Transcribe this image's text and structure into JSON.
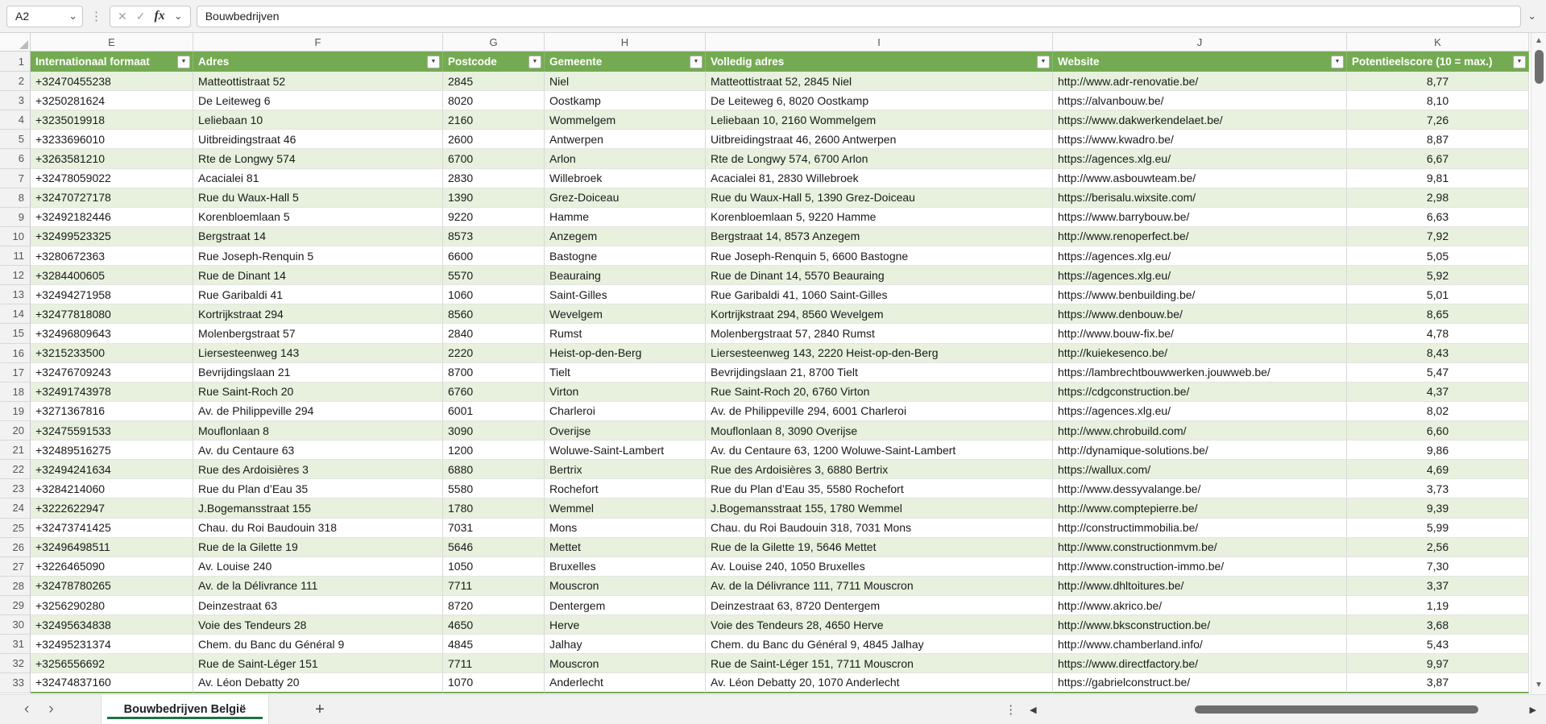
{
  "toolbar": {
    "name_box": "A2",
    "fx_label": "fx",
    "formula_value": "Bouwbedrijven"
  },
  "icons": {
    "chevron_down": "⌄",
    "cancel": "✕",
    "confirm": "✓",
    "kebab": "⋮",
    "prev": "‹",
    "next": "›",
    "plus": "+",
    "up": "▲",
    "down": "▼",
    "left": "◀",
    "right": "▶",
    "filter_arrow": "▼",
    "select_all_corner": "corner-triangle"
  },
  "colors": {
    "header_green": "#74AB52",
    "band_green": "#E7F1DE",
    "tab_underline_green": "#1E7145"
  },
  "columns": {
    "letters": [
      "E",
      "F",
      "G",
      "H",
      "I",
      "J",
      "K"
    ]
  },
  "table": {
    "headers": [
      "Internationaal formaat",
      "Adres",
      "Postcode",
      "Gemeente",
      "Volledig adres",
      "Website",
      "Potentieelscore (10 = max.)"
    ],
    "header_row_number": "1",
    "row_numbers": [
      "2",
      "3",
      "4",
      "5",
      "6",
      "7",
      "8",
      "9",
      "10",
      "11",
      "12",
      "13",
      "14",
      "15",
      "16",
      "17",
      "18",
      "19",
      "20",
      "21",
      "22",
      "23",
      "24",
      "25",
      "26",
      "27",
      "28",
      "29",
      "30",
      "31",
      "32",
      "33"
    ],
    "rows": [
      [
        "+32470455238",
        "Matteottistraat 52",
        "2845",
        "Niel",
        "Matteottistraat 52, 2845 Niel",
        "http://www.adr-renovatie.be/",
        "8,77"
      ],
      [
        "+3250281624",
        "De Leiteweg 6",
        "8020",
        "Oostkamp",
        "De Leiteweg 6, 8020 Oostkamp",
        "https://alvanbouw.be/",
        "8,10"
      ],
      [
        "+3235019918",
        "Leliebaan 10",
        "2160",
        "Wommelgem",
        "Leliebaan 10, 2160 Wommelgem",
        "https://www.dakwerkendelaet.be/",
        "7,26"
      ],
      [
        "+3233696010",
        "Uitbreidingstraat 46",
        "2600",
        "Antwerpen",
        "Uitbreidingstraat 46, 2600 Antwerpen",
        "https://www.kwadro.be/",
        "8,87"
      ],
      [
        "+3263581210",
        "Rte de Longwy 574",
        "6700",
        "Arlon",
        "Rte de Longwy 574, 6700 Arlon",
        "https://agences.xlg.eu/",
        "6,67"
      ],
      [
        "+32478059022",
        "Acacialei 81",
        "2830",
        "Willebroek",
        "Acacialei 81, 2830 Willebroek",
        "http://www.asbouwteam.be/",
        "9,81"
      ],
      [
        "+32470727178",
        "Rue du Waux-Hall 5",
        "1390",
        "Grez-Doiceau",
        "Rue du Waux-Hall 5, 1390 Grez-Doiceau",
        "https://berisalu.wixsite.com/",
        "2,98"
      ],
      [
        "+32492182446",
        "Korenbloemlaan 5",
        "9220",
        "Hamme",
        "Korenbloemlaan 5, 9220 Hamme",
        "https://www.barrybouw.be/",
        "6,63"
      ],
      [
        "+32499523325",
        "Bergstraat 14",
        "8573",
        "Anzegem",
        "Bergstraat 14, 8573 Anzegem",
        "http://www.renoperfect.be/",
        "7,92"
      ],
      [
        "+3280672363",
        "Rue Joseph-Renquin 5",
        "6600",
        "Bastogne",
        "Rue Joseph-Renquin 5, 6600 Bastogne",
        "https://agences.xlg.eu/",
        "5,05"
      ],
      [
        "+3284400605",
        "Rue de Dinant 14",
        "5570",
        "Beauraing",
        "Rue de Dinant 14, 5570 Beauraing",
        "https://agences.xlg.eu/",
        "5,92"
      ],
      [
        "+32494271958",
        "Rue Garibaldi 41",
        "1060",
        "Saint-Gilles",
        "Rue Garibaldi 41, 1060 Saint-Gilles",
        "https://www.benbuilding.be/",
        "5,01"
      ],
      [
        "+32477818080",
        "Kortrijkstraat 294",
        "8560",
        "Wevelgem",
        "Kortrijkstraat 294, 8560 Wevelgem",
        "https://www.denbouw.be/",
        "8,65"
      ],
      [
        "+32496809643",
        "Molenbergstraat 57",
        "2840",
        "Rumst",
        "Molenbergstraat 57, 2840 Rumst",
        "http://www.bouw-fix.be/",
        "4,78"
      ],
      [
        "+3215233500",
        "Liersesteenweg 143",
        "2220",
        "Heist-op-den-Berg",
        "Liersesteenweg 143, 2220 Heist-op-den-Berg",
        "http://kuiekesenco.be/",
        "8,43"
      ],
      [
        "+32476709243",
        "Bevrijdingslaan 21",
        "8700",
        "Tielt",
        "Bevrijdingslaan 21, 8700 Tielt",
        "https://lambrechtbouwwerken.jouwweb.be/",
        "5,47"
      ],
      [
        "+32491743978",
        "Rue Saint-Roch 20",
        "6760",
        "Virton",
        "Rue Saint-Roch 20, 6760 Virton",
        "https://cdgconstruction.be/",
        "4,37"
      ],
      [
        "+3271367816",
        "Av. de Philippeville 294",
        "6001",
        "Charleroi",
        "Av. de Philippeville 294, 6001 Charleroi",
        "https://agences.xlg.eu/",
        "8,02"
      ],
      [
        "+32475591533",
        "Mouflonlaan 8",
        "3090",
        "Overijse",
        "Mouflonlaan 8, 3090 Overijse",
        "http://www.chrobuild.com/",
        "6,60"
      ],
      [
        "+32489516275",
        "Av. du Centaure 63",
        "1200",
        "Woluwe-Saint-Lambert",
        "Av. du Centaure 63, 1200 Woluwe-Saint-Lambert",
        "http://dynamique-solutions.be/",
        "9,86"
      ],
      [
        "+32494241634",
        "Rue des Ardoisières 3",
        "6880",
        "Bertrix",
        "Rue des Ardoisières 3, 6880 Bertrix",
        "https://wallux.com/",
        "4,69"
      ],
      [
        "+3284214060",
        "Rue du Plan d’Eau 35",
        "5580",
        "Rochefort",
        "Rue du Plan d’Eau 35, 5580 Rochefort",
        "http://www.dessyvalange.be/",
        "3,73"
      ],
      [
        "+3222622947",
        "J.Bogemansstraat 155",
        "1780",
        "Wemmel",
        "J.Bogemansstraat 155, 1780 Wemmel",
        "http://www.comptepierre.be/",
        "9,39"
      ],
      [
        "+32473741425",
        "Chau. du Roi Baudouin 318",
        "7031",
        "Mons",
        "Chau. du Roi Baudouin 318, 7031 Mons",
        "http://constructimmobilia.be/",
        "5,99"
      ],
      [
        "+32496498511",
        "Rue de la Gilette 19",
        "5646",
        "Mettet",
        "Rue de la Gilette 19, 5646 Mettet",
        "http://www.constructionmvm.be/",
        "2,56"
      ],
      [
        "+3226465090",
        "Av. Louise 240",
        "1050",
        "Bruxelles",
        "Av. Louise 240, 1050 Bruxelles",
        "http://www.construction-immo.be/",
        "7,30"
      ],
      [
        "+32478780265",
        "Av. de la Délivrance 111",
        "7711",
        "Mouscron",
        "Av. de la Délivrance 111, 7711 Mouscron",
        "http://www.dhltoitures.be/",
        "3,37"
      ],
      [
        "+3256290280",
        "Deinzestraat 63",
        "8720",
        "Dentergem",
        "Deinzestraat 63, 8720 Dentergem",
        "http://www.akrico.be/",
        "1,19"
      ],
      [
        "+32495634838",
        "Voie des Tendeurs 28",
        "4650",
        "Herve",
        "Voie des Tendeurs 28, 4650 Herve",
        "http://www.bksconstruction.be/",
        "3,68"
      ],
      [
        "+32495231374",
        "Chem. du Banc du Général 9",
        "4845",
        "Jalhay",
        "Chem. du Banc du Général 9, 4845 Jalhay",
        "http://www.chamberland.info/",
        "5,43"
      ],
      [
        "+3256556692",
        "Rue de Saint-Léger 151",
        "7711",
        "Mouscron",
        "Rue de Saint-Léger 151, 7711 Mouscron",
        "https://www.directfactory.be/",
        "9,97"
      ],
      [
        "+32474837160",
        "Av. Léon Debatty 20",
        "1070",
        "Anderlecht",
        "Av. Léon Debatty 20, 1070 Anderlecht",
        "https://gabrielconstruct.be/",
        "3,87"
      ]
    ]
  },
  "sheet": {
    "active_tab": "Bouwbedrijven België"
  }
}
